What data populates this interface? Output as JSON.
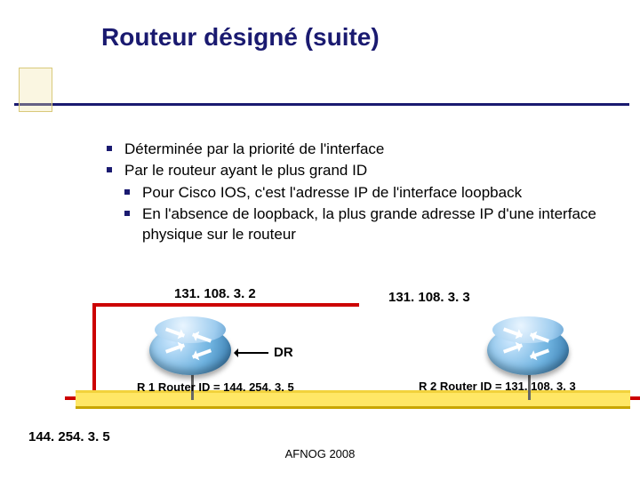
{
  "title": "Routeur désigné (suite)",
  "bullets": {
    "b1": "Déterminée par la priorité de l'interface",
    "b2": "Par le routeur ayant le plus grand ID",
    "b2a": "Pour  Cisco IOS, c'est l'adresse IP de l'interface loopback",
    "b2b": "En l'absence de loopback,  la plus grande adresse IP d'une interface physique sur le routeur"
  },
  "diagram": {
    "ip_left": "131. 108. 3. 2",
    "ip_right": "131. 108. 3. 3",
    "dr": "DR",
    "r1_id": "R 1 Router ID = 144. 254. 3. 5",
    "r2_id": "R 2 Router ID = 131. 108. 3. 3"
  },
  "footer_ip": "144. 254. 3. 5",
  "footnote": "AFNOG 2008"
}
